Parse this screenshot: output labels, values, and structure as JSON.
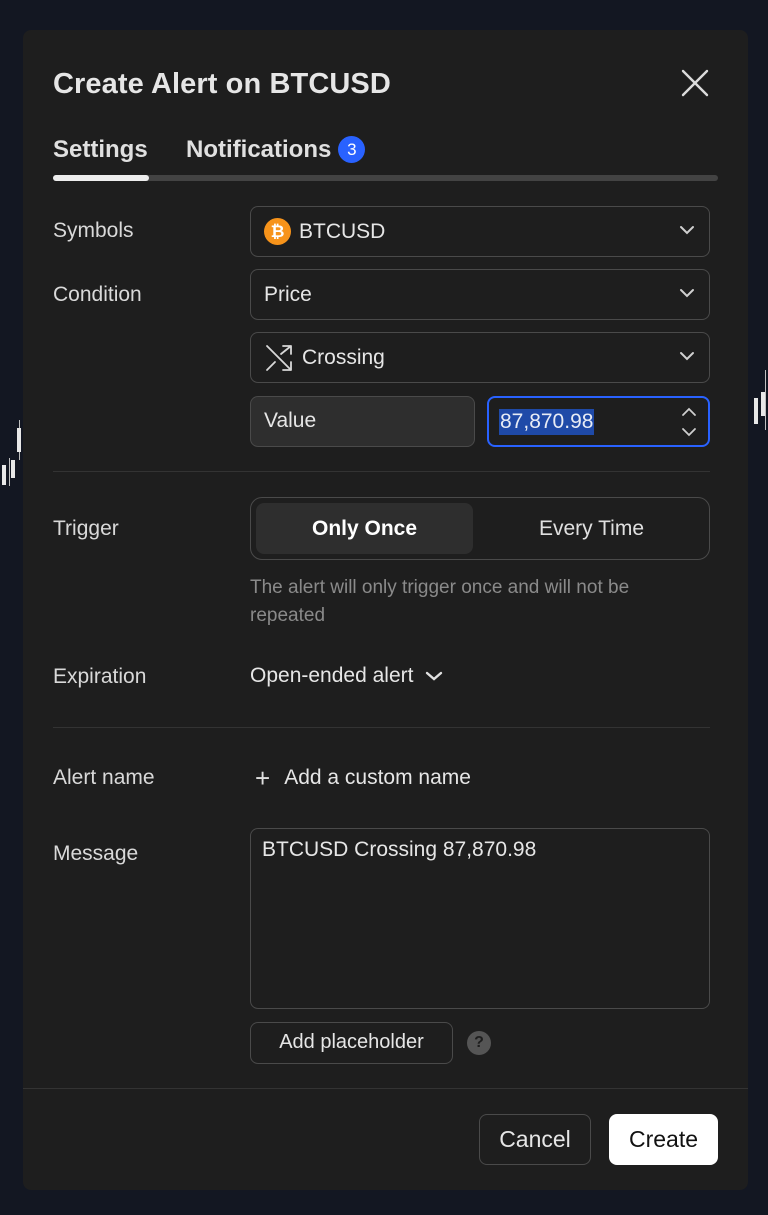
{
  "dialog": {
    "title": "Create Alert on BTCUSD",
    "tabs": [
      {
        "label": "Settings",
        "active": true
      },
      {
        "label": "Notifications",
        "badge": "3"
      }
    ]
  },
  "fields": {
    "symbols_label": "Symbols",
    "symbol": {
      "icon": "bitcoin-icon",
      "icon_glyph": "₿",
      "value": "BTCUSD"
    },
    "condition_label": "Condition",
    "condition_source": "Price",
    "condition_operator": {
      "icon": "crossing-icon",
      "value": "Crossing"
    },
    "value_type": "Value",
    "value": "87,870.98",
    "trigger_label": "Trigger",
    "trigger_options": [
      "Only Once",
      "Every Time"
    ],
    "trigger_selected": "Only Once",
    "trigger_hint": "The alert will only trigger once and will not be repeated",
    "expiration_label": "Expiration",
    "expiration_value": "Open-ended alert",
    "alert_name_label": "Alert name",
    "add_custom_name": "Add a custom name",
    "message_label": "Message",
    "message_value": "BTCUSD Crossing 87,870.98",
    "add_placeholder": "Add placeholder",
    "help_glyph": "?"
  },
  "footer": {
    "cancel": "Cancel",
    "create": "Create"
  },
  "colors": {
    "accent": "#2962ff",
    "bitcoin": "#f7931a",
    "background": "#1e1e1e"
  }
}
